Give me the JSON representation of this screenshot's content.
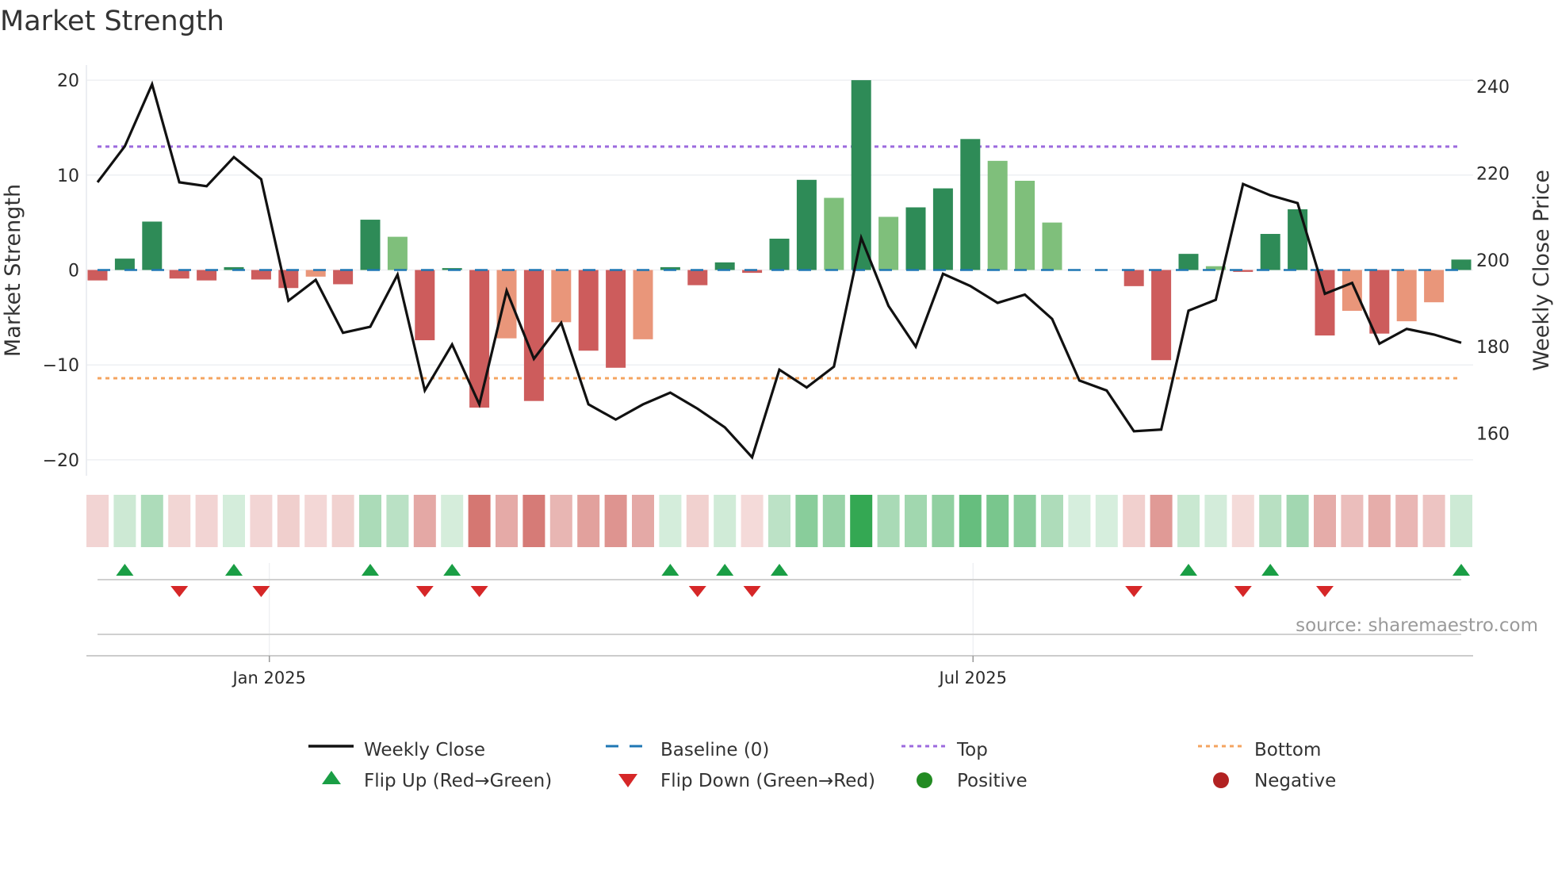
{
  "chart_data": {
    "type": "bar",
    "title": "Market Strength",
    "ylabel": "Market Strength",
    "y2label": "Weekly Close Price",
    "xlabel": "",
    "ylim": [
      -21.5,
      22
    ],
    "y2lim": [
      151,
      243
    ],
    "yticks": [
      "20",
      "10",
      "0",
      "−10",
      "−20"
    ],
    "ytick_values": [
      20,
      10,
      0,
      -10,
      -20
    ],
    "y2ticks": [
      "240",
      "220",
      "200",
      "180",
      "160"
    ],
    "y2tick_values": [
      240,
      220,
      200,
      180,
      160
    ],
    "xticks": [
      "Jan 2025",
      "Jul 2025"
    ],
    "xtick_week_index": [
      6.3,
      32.1
    ],
    "grid": true,
    "strength": [
      -1.1,
      1.2,
      5.1,
      -0.9,
      -1.1,
      0.3,
      -1.0,
      -1.9,
      -0.7,
      -1.5,
      5.3,
      3.5,
      -7.4,
      0.2,
      -14.5,
      -7.2,
      -13.8,
      -5.5,
      -8.5,
      -10.3,
      -7.3,
      0.3,
      -1.6,
      0.8,
      -0.3,
      3.3,
      9.5,
      7.6,
      20.0,
      5.6,
      6.6,
      8.6,
      13.8,
      11.5,
      9.4,
      5.0,
      0,
      0,
      -1.7,
      -9.5,
      1.7,
      0.4,
      -0.2,
      3.8,
      6.4,
      -6.9,
      -4.3,
      -6.7,
      -5.4,
      -3.4,
      1.1
    ],
    "weekly_close": [
      217.9,
      226.2,
      240.5,
      217.9,
      217.0,
      223.7,
      218.6,
      190.6,
      195.4,
      183.2,
      184.6,
      196.6,
      169.9,
      180.5,
      166.7,
      192.9,
      177.2,
      185.5,
      166.7,
      163.2,
      166.7,
      169.4,
      165.7,
      161.4,
      154.5,
      174.7,
      170.6,
      175.4,
      205.1,
      189.4,
      180.0,
      196.8,
      194.0,
      190.1,
      192.0,
      186.4,
      172.2,
      169.9,
      160.5,
      160.9,
      188.3,
      190.8,
      217.5,
      214.9,
      213.1,
      192.2,
      194.7,
      180.7,
      184.1,
      182.8,
      180.9
    ],
    "baseline": 0,
    "top": 13.0,
    "bottom": -11.4,
    "flip_up_weeks": [
      1,
      5,
      10,
      13,
      21,
      23,
      25,
      40,
      43,
      50
    ],
    "flip_down_weeks": [
      3,
      6,
      12,
      14,
      22,
      24,
      38,
      42,
      45
    ],
    "colors": {
      "up_strong": "#2e8b57",
      "up_weak": "#7fbf7b",
      "down_strong": "#cd5c5c",
      "down_weak": "#e9967a",
      "line": "#111111",
      "baseline": "#1f77b4",
      "top": "#9c6ade",
      "bottom": "#f4a460",
      "flip_up": "#1a9e45",
      "flip_down": "#d62728",
      "positive": "#228b22",
      "negative": "#b22222"
    },
    "legend_position": "bottom",
    "legend": [
      "Weekly Close",
      "Baseline (0)",
      "Top",
      "Bottom",
      "Flip Up (Red→Green)",
      "Flip Down (Green→Red)",
      "Positive",
      "Negative"
    ],
    "source": "source: sharemaestro.com"
  }
}
